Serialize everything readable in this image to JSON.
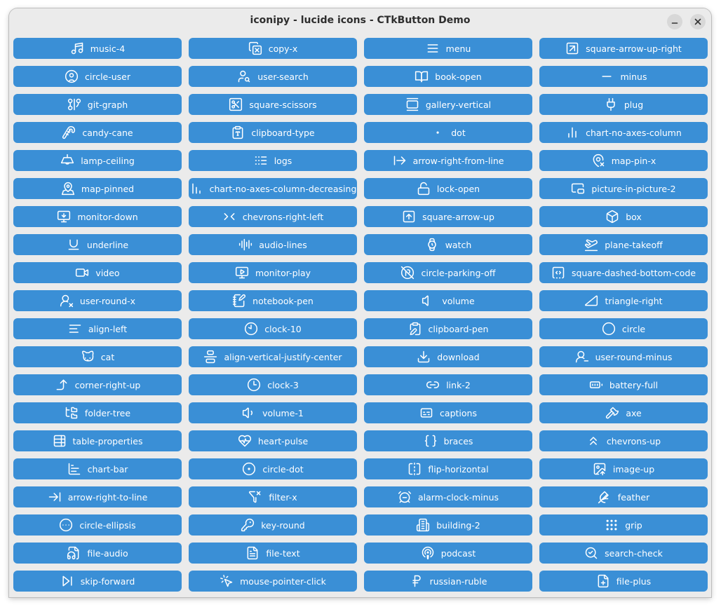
{
  "window": {
    "title": "iconipy - lucide icons - CTkButton Demo"
  },
  "colors": {
    "button_bg": "#3a8fd6",
    "button_text": "#ffffff",
    "window_bg": "#ebebeb"
  },
  "buttons": [
    {
      "label": "music-4",
      "icon": "music-4-icon"
    },
    {
      "label": "copy-x",
      "icon": "copy-x-icon"
    },
    {
      "label": "menu",
      "icon": "menu-icon"
    },
    {
      "label": "square-arrow-up-right",
      "icon": "square-arrow-up-right-icon"
    },
    {
      "label": "circle-user",
      "icon": "circle-user-icon"
    },
    {
      "label": "user-search",
      "icon": "user-search-icon"
    },
    {
      "label": "book-open",
      "icon": "book-open-icon"
    },
    {
      "label": "minus",
      "icon": "minus-icon"
    },
    {
      "label": "git-graph",
      "icon": "git-graph-icon"
    },
    {
      "label": "square-scissors",
      "icon": "square-scissors-icon"
    },
    {
      "label": "gallery-vertical",
      "icon": "gallery-vertical-icon"
    },
    {
      "label": "plug",
      "icon": "plug-icon"
    },
    {
      "label": "candy-cane",
      "icon": "candy-cane-icon"
    },
    {
      "label": "clipboard-type",
      "icon": "clipboard-type-icon"
    },
    {
      "label": "dot",
      "icon": "dot-icon"
    },
    {
      "label": "chart-no-axes-column",
      "icon": "chart-no-axes-column-icon"
    },
    {
      "label": "lamp-ceiling",
      "icon": "lamp-ceiling-icon"
    },
    {
      "label": "logs",
      "icon": "logs-icon"
    },
    {
      "label": "arrow-right-from-line",
      "icon": "arrow-right-from-line-icon"
    },
    {
      "label": "map-pin-x",
      "icon": "map-pin-x-icon"
    },
    {
      "label": "map-pinned",
      "icon": "map-pinned-icon"
    },
    {
      "label": "chart-no-axes-column-decreasing",
      "icon": "chart-no-axes-column-decreasing-icon"
    },
    {
      "label": "lock-open",
      "icon": "lock-open-icon"
    },
    {
      "label": "picture-in-picture-2",
      "icon": "picture-in-picture-2-icon"
    },
    {
      "label": "monitor-down",
      "icon": "monitor-down-icon"
    },
    {
      "label": "chevrons-right-left",
      "icon": "chevrons-right-left-icon"
    },
    {
      "label": "square-arrow-up",
      "icon": "square-arrow-up-icon"
    },
    {
      "label": "box",
      "icon": "box-icon"
    },
    {
      "label": "underline",
      "icon": "underline-icon"
    },
    {
      "label": "audio-lines",
      "icon": "audio-lines-icon"
    },
    {
      "label": "watch",
      "icon": "watch-icon"
    },
    {
      "label": "plane-takeoff",
      "icon": "plane-takeoff-icon"
    },
    {
      "label": "video",
      "icon": "video-icon"
    },
    {
      "label": "monitor-play",
      "icon": "monitor-play-icon"
    },
    {
      "label": "circle-parking-off",
      "icon": "circle-parking-off-icon"
    },
    {
      "label": "square-dashed-bottom-code",
      "icon": "square-dashed-bottom-code-icon"
    },
    {
      "label": "user-round-x",
      "icon": "user-round-x-icon"
    },
    {
      "label": "notebook-pen",
      "icon": "notebook-pen-icon"
    },
    {
      "label": "volume",
      "icon": "volume-icon"
    },
    {
      "label": "triangle-right",
      "icon": "triangle-right-icon"
    },
    {
      "label": "align-left",
      "icon": "align-left-icon"
    },
    {
      "label": "clock-10",
      "icon": "clock-10-icon"
    },
    {
      "label": "clipboard-pen",
      "icon": "clipboard-pen-icon"
    },
    {
      "label": "circle",
      "icon": "circle-icon"
    },
    {
      "label": "cat",
      "icon": "cat-icon"
    },
    {
      "label": "align-vertical-justify-center",
      "icon": "align-vertical-justify-center-icon"
    },
    {
      "label": "download",
      "icon": "download-icon"
    },
    {
      "label": "user-round-minus",
      "icon": "user-round-minus-icon"
    },
    {
      "label": "corner-right-up",
      "icon": "corner-right-up-icon"
    },
    {
      "label": "clock-3",
      "icon": "clock-3-icon"
    },
    {
      "label": "link-2",
      "icon": "link-2-icon"
    },
    {
      "label": "battery-full",
      "icon": "battery-full-icon"
    },
    {
      "label": "folder-tree",
      "icon": "folder-tree-icon"
    },
    {
      "label": "volume-1",
      "icon": "volume-1-icon"
    },
    {
      "label": "captions",
      "icon": "captions-icon"
    },
    {
      "label": "axe",
      "icon": "axe-icon"
    },
    {
      "label": "table-properties",
      "icon": "table-properties-icon"
    },
    {
      "label": "heart-pulse",
      "icon": "heart-pulse-icon"
    },
    {
      "label": "braces",
      "icon": "braces-icon"
    },
    {
      "label": "chevrons-up",
      "icon": "chevrons-up-icon"
    },
    {
      "label": "chart-bar",
      "icon": "chart-bar-icon"
    },
    {
      "label": "circle-dot",
      "icon": "circle-dot-icon"
    },
    {
      "label": "flip-horizontal",
      "icon": "flip-horizontal-icon"
    },
    {
      "label": "image-up",
      "icon": "image-up-icon"
    },
    {
      "label": "arrow-right-to-line",
      "icon": "arrow-right-to-line-icon"
    },
    {
      "label": "filter-x",
      "icon": "filter-x-icon"
    },
    {
      "label": "alarm-clock-minus",
      "icon": "alarm-clock-minus-icon"
    },
    {
      "label": "feather",
      "icon": "feather-icon"
    },
    {
      "label": "circle-ellipsis",
      "icon": "circle-ellipsis-icon"
    },
    {
      "label": "key-round",
      "icon": "key-round-icon"
    },
    {
      "label": "building-2",
      "icon": "building-2-icon"
    },
    {
      "label": "grip",
      "icon": "grip-icon"
    },
    {
      "label": "file-audio",
      "icon": "file-audio-icon"
    },
    {
      "label": "file-text",
      "icon": "file-text-icon"
    },
    {
      "label": "podcast",
      "icon": "podcast-icon"
    },
    {
      "label": "search-check",
      "icon": "search-check-icon"
    },
    {
      "label": "skip-forward",
      "icon": "skip-forward-icon"
    },
    {
      "label": "mouse-pointer-click",
      "icon": "mouse-pointer-click-icon"
    },
    {
      "label": "russian-ruble",
      "icon": "russian-ruble-icon"
    },
    {
      "label": "file-plus",
      "icon": "file-plus-icon"
    }
  ]
}
